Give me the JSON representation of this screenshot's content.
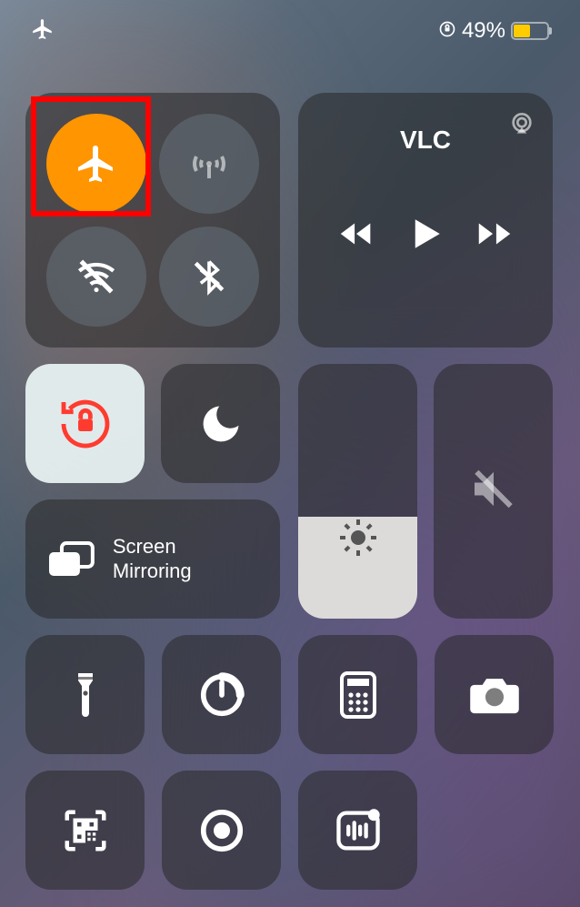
{
  "status": {
    "battery_percent": "49%",
    "battery_level": 49
  },
  "media": {
    "app_name": "VLC"
  },
  "screen_mirroring": {
    "label": "Screen Mirroring"
  },
  "brightness": {
    "level": 40
  },
  "volume": {
    "level": 0,
    "muted": true
  },
  "connectivity": {
    "airplane_mode": true,
    "cellular": false,
    "wifi": false,
    "bluetooth": false
  },
  "toggles": {
    "orientation_lock": true,
    "do_not_disturb": false
  },
  "highlight": {
    "target": "airplane-mode"
  }
}
